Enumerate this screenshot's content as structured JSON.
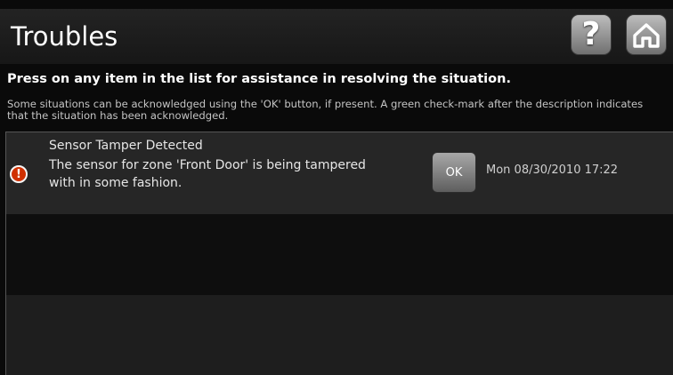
{
  "header": {
    "title": "Troubles",
    "help_icon": "question-mark",
    "home_icon": "home",
    "help_glyph": "?"
  },
  "instructions": {
    "primary": "Press on any item in the list for assistance in resolving the situation.",
    "secondary": "Some situations can be acknowledged using the 'OK' button, if present. A green check-mark after the description indicates that the situation has been acknowledged."
  },
  "troubles": [
    {
      "icon": "warning-exclamation",
      "icon_glyph": "!",
      "title": "Sensor Tamper Detected",
      "description": "The sensor for zone 'Front Door' is being tampered with in some fashion.",
      "ok_label": "OK",
      "timestamp": "Mon 08/30/2010 17:22"
    }
  ],
  "colors": {
    "warning": "#d03000",
    "background": "#0a0a0a",
    "header": "#1e1e1e"
  }
}
